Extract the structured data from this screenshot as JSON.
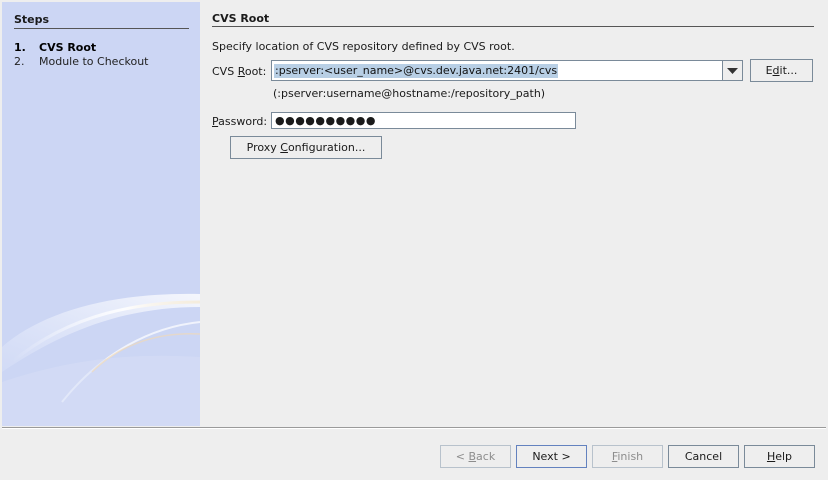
{
  "steps": {
    "title": "Steps",
    "items": [
      {
        "num": "1.",
        "label": "CVS Root",
        "active": true
      },
      {
        "num": "2.",
        "label": "Module to Checkout",
        "active": false
      }
    ]
  },
  "content": {
    "title": "CVS Root",
    "description": "Specify location of CVS repository defined by CVS root.",
    "cvs_root": {
      "label_pre": "CVS ",
      "label_mnemonic": "R",
      "label_post": "oot:",
      "value": ":pserver:<user_name>@cvs.dev.java.net:2401/cvs",
      "edit_pre": "E",
      "edit_mnemonic": "d",
      "edit_post": "it...",
      "hint": "(:pserver:username@hostname:/repository_path)"
    },
    "password": {
      "label_mnemonic": "P",
      "label_post": "assword:",
      "value": "●●●●●●●●●●"
    },
    "proxy": {
      "label_pre": "Proxy ",
      "label_mnemonic": "C",
      "label_post": "onfiguration..."
    }
  },
  "footer": {
    "back": {
      "pre": "< ",
      "mnemonic": "B",
      "post": "ack"
    },
    "next": "Next >",
    "finish": {
      "mnemonic": "F",
      "post": "inish"
    },
    "cancel": "Cancel",
    "help": {
      "mnemonic": "H",
      "post": "elp"
    }
  },
  "colors": {
    "panel_bg": "#ccd6f4",
    "selection": "#b8cfe5",
    "window_bg": "#eeeeee"
  }
}
